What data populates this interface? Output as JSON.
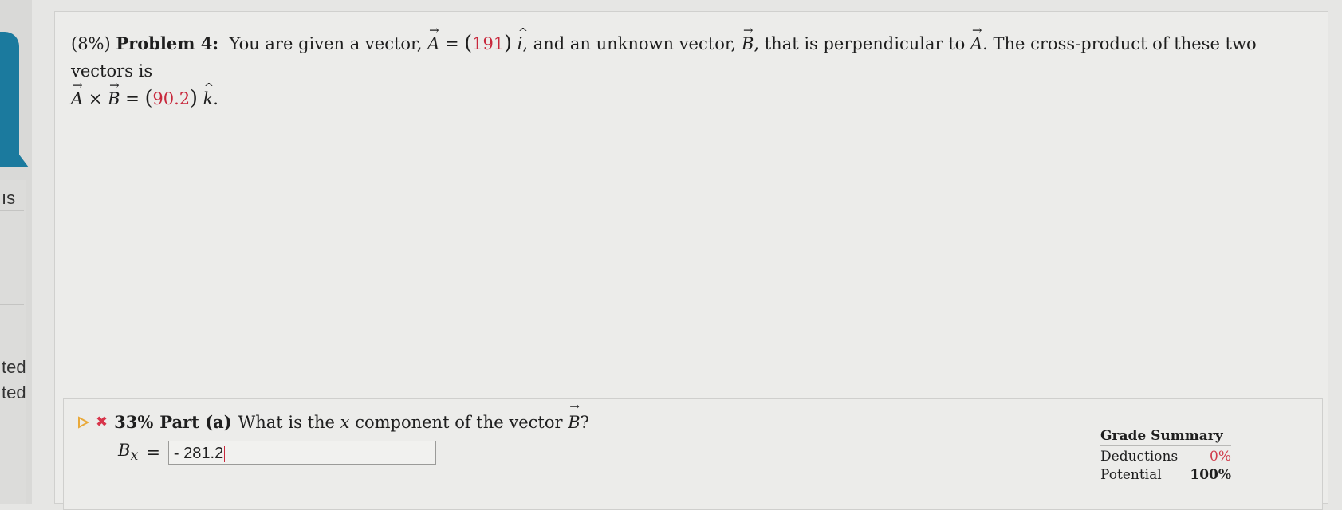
{
  "sidebar": {
    "fragments": [
      "ıs",
      "ted",
      "ted"
    ]
  },
  "problem": {
    "weight": "(8%)",
    "title": "Problem 4:",
    "text_1": "You are given a vector,",
    "vec_a": "A",
    "equals": "=",
    "a_value": "191",
    "unit_i": "i",
    "text_2": ", and an unknown vector,",
    "vec_b": "B",
    "text_3": ", that is perpendicular to",
    "text_4": ". The cross-product of these two vectors is",
    "times": "×",
    "cross_value": "90.2",
    "unit_k": "k",
    "end": "."
  },
  "part_a": {
    "score": "33%",
    "label": "Part (a)",
    "question_1": "What is the",
    "variable": "x",
    "question_2": "component of the vector",
    "question_end": "?",
    "answer_label": "B",
    "answer_sub": "x",
    "answer_eq": "=",
    "answer_value": "- 281.2"
  },
  "grade_summary": {
    "title": "Grade Summary",
    "deductions_label": "Deductions",
    "deductions_value": "0%",
    "potential_label": "Potential",
    "potential_value": "100%"
  },
  "colors": {
    "accent_red": "#c8283c",
    "sidebar_blue": "#1b7a9e",
    "play_orange": "#e9a93a"
  }
}
